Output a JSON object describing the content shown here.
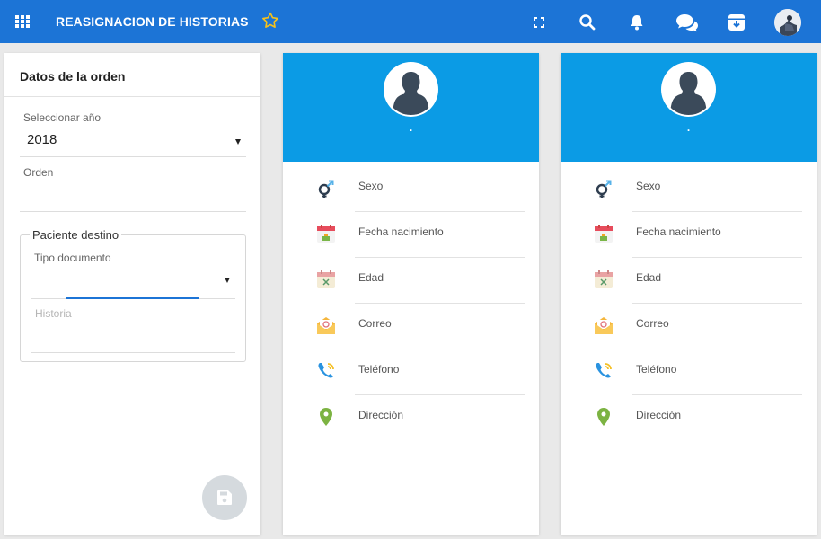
{
  "app": {
    "title": "REASIGNACION DE HISTORIAS",
    "accent_color": "#1c74d6",
    "header_color": "#0b9be5"
  },
  "topbar_icons": [
    "apps-grid-icon",
    "favorite-star-icon",
    "fullscreen-icon",
    "search-icon",
    "notifications-bell-icon",
    "chat-icon",
    "archive-icon",
    "user-avatar"
  ],
  "order_panel": {
    "title": "Datos de la orden",
    "year_label": "Seleccionar año",
    "year_value": "2018",
    "order_label": "Orden",
    "order_value": "",
    "destination": {
      "legend": "Paciente destino",
      "doc_type_label": "Tipo documento",
      "doc_type_value": "",
      "history_placeholder": "Historia"
    },
    "save_icon": "floppy-disk-icon"
  },
  "cards": [
    {
      "name": ".",
      "rows": [
        {
          "label": "Sexo",
          "icon": "gender-icon"
        },
        {
          "label": "Fecha nacimiento",
          "icon": "calendar-birthday-icon"
        },
        {
          "label": "Edad",
          "icon": "calendar-age-icon"
        },
        {
          "label": "Correo",
          "icon": "email-icon"
        },
        {
          "label": "Teléfono",
          "icon": "phone-icon"
        },
        {
          "label": "Dirección",
          "icon": "location-pin-icon"
        }
      ]
    },
    {
      "name": ".",
      "rows": [
        {
          "label": "Sexo",
          "icon": "gender-icon"
        },
        {
          "label": "Fecha nacimiento",
          "icon": "calendar-birthday-icon"
        },
        {
          "label": "Edad",
          "icon": "calendar-age-icon"
        },
        {
          "label": "Correo",
          "icon": "email-icon"
        },
        {
          "label": "Teléfono",
          "icon": "phone-icon"
        },
        {
          "label": "Dirección",
          "icon": "location-pin-icon"
        }
      ]
    }
  ]
}
